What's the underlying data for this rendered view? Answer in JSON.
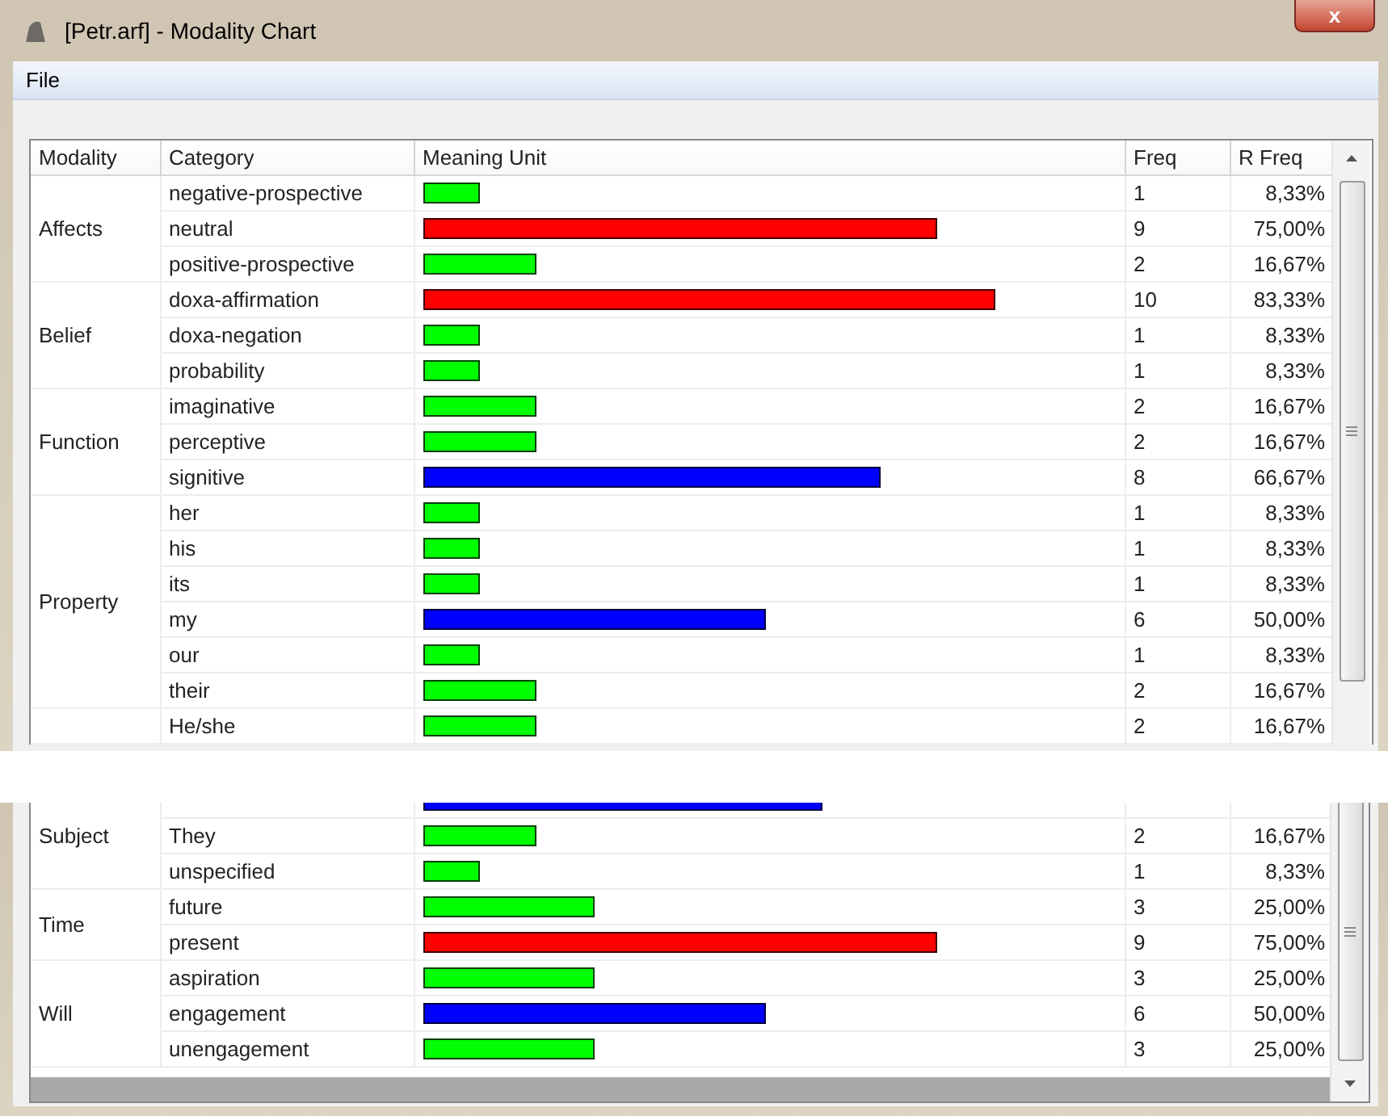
{
  "window": {
    "title": "[Petr.arf] - Modality Chart",
    "close": "x"
  },
  "menu": [
    "File"
  ],
  "table": {
    "columns": [
      "Modality",
      "Category",
      "Meaning Unit",
      "Freq",
      "R Freq"
    ],
    "sections": [
      {
        "groups": [
          {
            "modality": "Affects",
            "rows": [
              {
                "category": "negative-prospective",
                "level": 0.0833,
                "color": "#00ff00",
                "freq": "1",
                "rfreq": "8,33%"
              },
              {
                "category": "neutral",
                "level": 0.75,
                "color": "#ff0000",
                "freq": "9",
                "rfreq": "75,00%"
              },
              {
                "category": "positive-prospective",
                "level": 0.1667,
                "color": "#00ff00",
                "freq": "2",
                "rfreq": "16,67%"
              }
            ]
          },
          {
            "modality": "Belief",
            "rows": [
              {
                "category": "doxa-affirmation",
                "level": 0.8333,
                "color": "#ff0000",
                "freq": "10",
                "rfreq": "83,33%"
              },
              {
                "category": "doxa-negation",
                "level": 0.0833,
                "color": "#00ff00",
                "freq": "1",
                "rfreq": "8,33%"
              },
              {
                "category": "probability",
                "level": 0.0833,
                "color": "#00ff00",
                "freq": "1",
                "rfreq": "8,33%"
              }
            ]
          },
          {
            "modality": "Function",
            "rows": [
              {
                "category": "imaginative",
                "level": 0.1667,
                "color": "#00ff00",
                "freq": "2",
                "rfreq": "16,67%"
              },
              {
                "category": "perceptive",
                "level": 0.1667,
                "color": "#00ff00",
                "freq": "2",
                "rfreq": "16,67%"
              },
              {
                "category": "signitive",
                "level": 0.6667,
                "color": "#0000ff",
                "freq": "8",
                "rfreq": "66,67%"
              }
            ]
          },
          {
            "modality": "Property",
            "rows": [
              {
                "category": "her",
                "level": 0.0833,
                "color": "#00ff00",
                "freq": "1",
                "rfreq": "8,33%"
              },
              {
                "category": "his",
                "level": 0.0833,
                "color": "#00ff00",
                "freq": "1",
                "rfreq": "8,33%"
              },
              {
                "category": "its",
                "level": 0.0833,
                "color": "#00ff00",
                "freq": "1",
                "rfreq": "8,33%"
              },
              {
                "category": "my",
                "level": 0.5,
                "color": "#0000ff",
                "freq": "6",
                "rfreq": "50,00%"
              },
              {
                "category": "our",
                "level": 0.0833,
                "color": "#00ff00",
                "freq": "1",
                "rfreq": "8,33%"
              },
              {
                "category": "their",
                "level": 0.1667,
                "color": "#00ff00",
                "freq": "2",
                "rfreq": "16,67%"
              }
            ]
          },
          {
            "rows": [
              {
                "category": "He/she",
                "level": 0.1667,
                "color": "#00ff00",
                "freq": "2",
                "rfreq": "16,67%"
              }
            ]
          }
        ]
      },
      {
        "groups": [
          {
            "modality": "Subject",
            "rows": [
              {
                "level": 0.5833,
                "color": "#0000ff"
              },
              {
                "category": "They",
                "level": 0.1667,
                "color": "#00ff00",
                "freq": "2",
                "rfreq": "16,67%"
              },
              {
                "category": "unspecified",
                "level": 0.0833,
                "color": "#00ff00",
                "freq": "1",
                "rfreq": "8,33%"
              }
            ]
          },
          {
            "modality": "Time",
            "rows": [
              {
                "category": "future",
                "level": 0.25,
                "color": "#00ff00",
                "freq": "3",
                "rfreq": "25,00%"
              },
              {
                "category": "present",
                "level": 0.75,
                "color": "#ff0000",
                "freq": "9",
                "rfreq": "75,00%"
              }
            ]
          },
          {
            "modality": "Will",
            "rows": [
              {
                "category": "aspiration",
                "level": 0.25,
                "color": "#00ff00",
                "freq": "3",
                "rfreq": "25,00%"
              },
              {
                "category": "engagement",
                "level": 0.5,
                "color": "#0000ff",
                "freq": "6",
                "rfreq": "50,00%"
              },
              {
                "category": "unengagement",
                "level": 0.25,
                "color": "#00ff00",
                "freq": "3",
                "rfreq": "25,00%"
              }
            ]
          }
        ]
      }
    ]
  }
}
